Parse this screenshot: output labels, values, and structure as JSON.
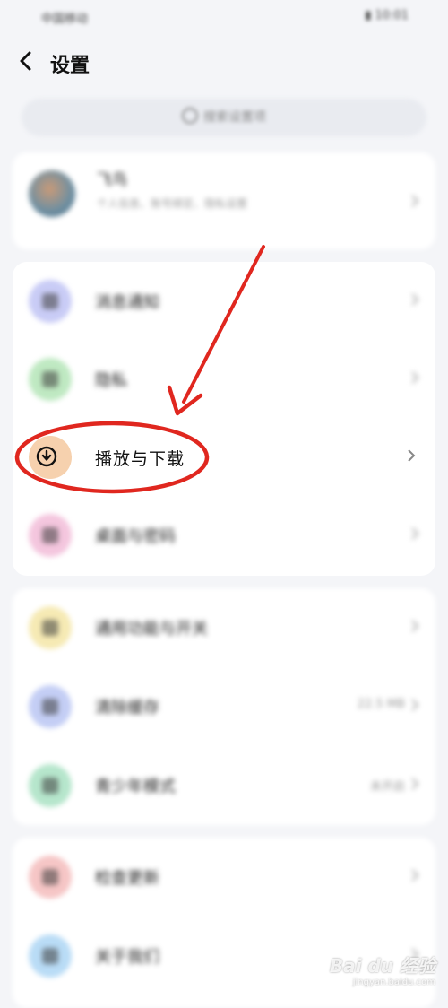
{
  "status_bar": {
    "carrier": "中国移动 ",
    "right": "▮ 10:01"
  },
  "header": {
    "title": "设置"
  },
  "search": {
    "placeholder": "搜索设置项"
  },
  "profile": {
    "name": "飞鸟",
    "subtitle": "个人信息、账号绑定、隐私设置"
  },
  "group1": {
    "items": [
      {
        "label": "消息通知",
        "icon": "bell-icon",
        "color": "#c9ccf6"
      },
      {
        "label": "隐私",
        "icon": "lock-icon",
        "color": "#bfe9c2"
      },
      {
        "label": "播放与下载",
        "icon": "download-icon",
        "color": "#f6d1ae"
      },
      {
        "label": "桌面与密码",
        "icon": "desktop-icon",
        "color": "#f4c6de"
      }
    ]
  },
  "group2": {
    "items": [
      {
        "label": "通用功能与开关",
        "icon": "toggle-icon",
        "color": "#f6eab4",
        "value": ""
      },
      {
        "label": "清除缓存",
        "icon": "trash-icon",
        "color": "#c4cef5",
        "value": "22.5 MB"
      },
      {
        "label": "青少年模式",
        "icon": "shield-icon",
        "color": "#b6e6cc",
        "value": "未开启"
      }
    ]
  },
  "group3": {
    "items": [
      {
        "label": "检查更新",
        "icon": "refresh-icon",
        "color": "#f6c6c6"
      },
      {
        "label": "关于我们",
        "icon": "info-icon",
        "color": "#b9dcf6"
      }
    ]
  },
  "watermark": {
    "brand": "Bai du 经验",
    "url": "jingyan.baidu.com"
  },
  "colors": {
    "annotation": "#e0271f",
    "background": "#f4f5f8"
  }
}
